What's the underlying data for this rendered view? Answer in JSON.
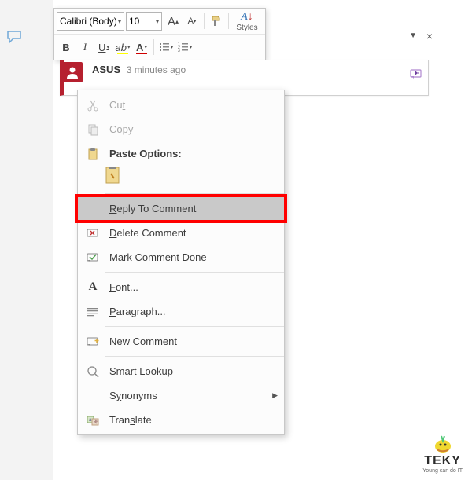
{
  "toolbar": {
    "font_name": "Calibri (Body)",
    "font_size": "10",
    "bold": "B",
    "italic": "I",
    "underline": "U",
    "styles_label": "Styles"
  },
  "comment": {
    "user": "ASUS",
    "timestamp": "3 minutes ago"
  },
  "pane": {
    "close": "×"
  },
  "menu": {
    "cut": "Cut",
    "copy": "Copy",
    "paste_options": "Paste Options:",
    "reply": "Reply To Comment",
    "delete": "Delete Comment",
    "mark_done": "Mark Comment Done",
    "font": "Font...",
    "paragraph": "Paragraph...",
    "new_comment": "New Comment",
    "smart_lookup": "Smart Lookup",
    "synonyms": "Synonyms",
    "translate": "Translate"
  },
  "logo": {
    "brand": "TEKY",
    "tagline": "Young can do IT"
  }
}
